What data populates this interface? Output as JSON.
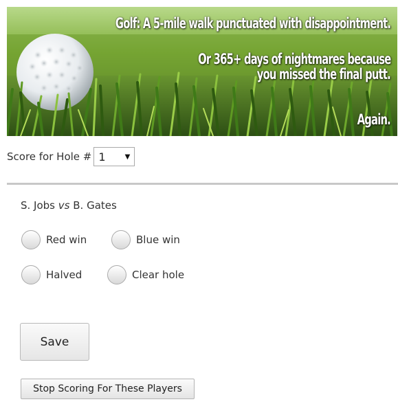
{
  "banner": {
    "line1": "Golf: A 5-mile walk punctuated with disappointment.",
    "line2": "Or 365+ days of nightmares because",
    "line3": "you missed the final putt.",
    "line4": "Again."
  },
  "hole_selector": {
    "label": "Score for Hole #",
    "selected": "1"
  },
  "match": {
    "player1": "S. Jobs",
    "vs": "vs",
    "player2": "B. Gates"
  },
  "options": {
    "red_win": "Red win",
    "blue_win": "Blue win",
    "halved": "Halved",
    "clear_hole": "Clear hole"
  },
  "buttons": {
    "save": "Save",
    "stop": "Stop Scoring For These Players"
  },
  "colors": {
    "grass_dark": "#2f5514",
    "grass_light": "#8fbf3a",
    "divider": "#c8c8c8"
  },
  "icons": {
    "dropdown": "caret-down-icon",
    "banner_image": "golf-ball-on-grass"
  }
}
